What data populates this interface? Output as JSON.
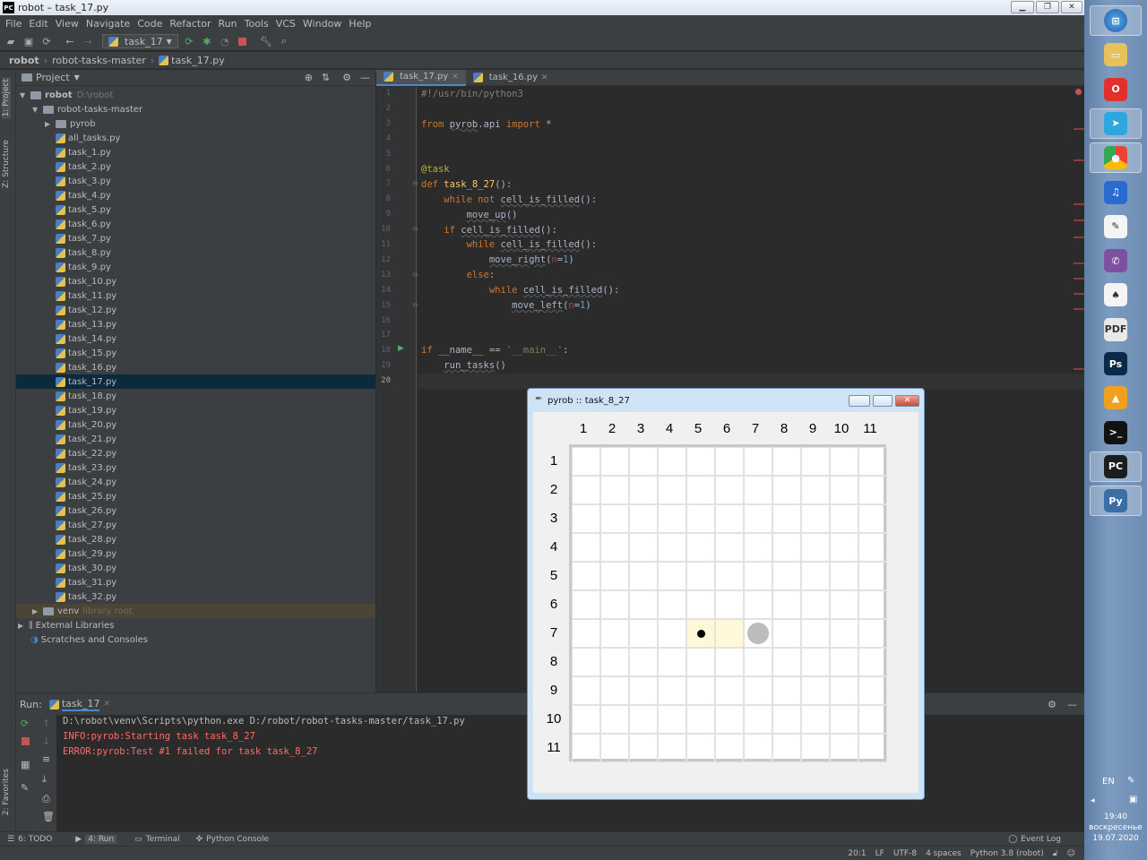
{
  "window": {
    "title": "robot – task_17.py",
    "logo": "PC"
  },
  "menu": [
    "File",
    "Edit",
    "View",
    "Navigate",
    "Code",
    "Refactor",
    "Run",
    "Tools",
    "VCS",
    "Window",
    "Help"
  ],
  "toolbar": {
    "run_config": "task_17"
  },
  "breadcrumb": [
    "robot",
    "robot-tasks-master",
    "task_17.py"
  ],
  "side_tabs": {
    "project": "1: Project",
    "structure": "Z: Structure",
    "favorites": "2: Favorites"
  },
  "project": {
    "header": "Project",
    "root": {
      "name": "robot",
      "path": "D:\\robot"
    },
    "folder": "robot-tasks-master",
    "subfolder": "pyrob",
    "files": [
      "all_tasks.py",
      "task_1.py",
      "task_2.py",
      "task_3.py",
      "task_4.py",
      "task_5.py",
      "task_6.py",
      "task_7.py",
      "task_8.py",
      "task_9.py",
      "task_10.py",
      "task_11.py",
      "task_12.py",
      "task_13.py",
      "task_14.py",
      "task_15.py",
      "task_16.py",
      "task_17.py",
      "task_18.py",
      "task_19.py",
      "task_20.py",
      "task_21.py",
      "task_22.py",
      "task_23.py",
      "task_24.py",
      "task_25.py",
      "task_26.py",
      "task_27.py",
      "task_28.py",
      "task_29.py",
      "task_30.py",
      "task_31.py",
      "task_32.py"
    ],
    "selected": "task_17.py",
    "venv": {
      "name": "venv",
      "note": "library root"
    },
    "external": "External Libraries",
    "scratches": "Scratches and Consoles"
  },
  "editor": {
    "tabs": [
      "task_17.py",
      "task_16.py"
    ],
    "active_tab": "task_17.py",
    "line_numbers": [
      "1",
      "2",
      "3",
      "4",
      "5",
      "6",
      "7",
      "8",
      "9",
      "10",
      "11",
      "12",
      "13",
      "14",
      "15",
      "16",
      "17",
      "18",
      "19",
      "20"
    ]
  },
  "run": {
    "label": "Run:",
    "tab": "task_17",
    "lines": [
      "D:\\robot\\venv\\Scripts\\python.exe D:/robot/robot-tasks-master/task_17.py",
      "INFO:pyrob:Starting task task_8_27",
      "ERROR:pyrob:Test #1 failed for task task_8_27"
    ]
  },
  "tool_windows": [
    "6: TODO",
    "4: Run",
    "Terminal",
    "Python Console",
    "Event Log"
  ],
  "status": [
    "20:1",
    "LF",
    "UTF-8",
    "4 spaces",
    "Python 3.8 (robot)"
  ],
  "pyrob": {
    "title": "pyrob :: task_8_27",
    "columns": [
      "1",
      "2",
      "3",
      "4",
      "5",
      "6",
      "7",
      "8",
      "9",
      "10",
      "11"
    ],
    "rows": [
      "1",
      "2",
      "3",
      "4",
      "5",
      "6",
      "7",
      "8",
      "9",
      "10",
      "11"
    ],
    "filled_cells": [
      [
        7,
        5
      ],
      [
        7,
        6
      ]
    ],
    "robot": {
      "row": 7,
      "col": 5
    },
    "target": {
      "row": 7,
      "col": 7
    },
    "fill_color": "#fff8d8"
  },
  "taskbar": {
    "lang": "EN",
    "time": "19:40",
    "day": "воскресенье",
    "date": "19.07.2020",
    "apps": [
      "start-orb-icon",
      "folder-icon",
      "opera-icon",
      "telegram-icon",
      "chrome-icon",
      "headphones-icon",
      "notes-icon",
      "viber-icon",
      "solitaire-icon",
      "pdf-icon",
      "photoshop-icon",
      "aimp-icon",
      "cmd-icon",
      "pycharm-icon",
      "python-icon"
    ]
  },
  "colors": {
    "accent": "#4a88c7",
    "error": "#ff6b68",
    "keyword": "#cc7832",
    "function": "#ffc66d"
  }
}
